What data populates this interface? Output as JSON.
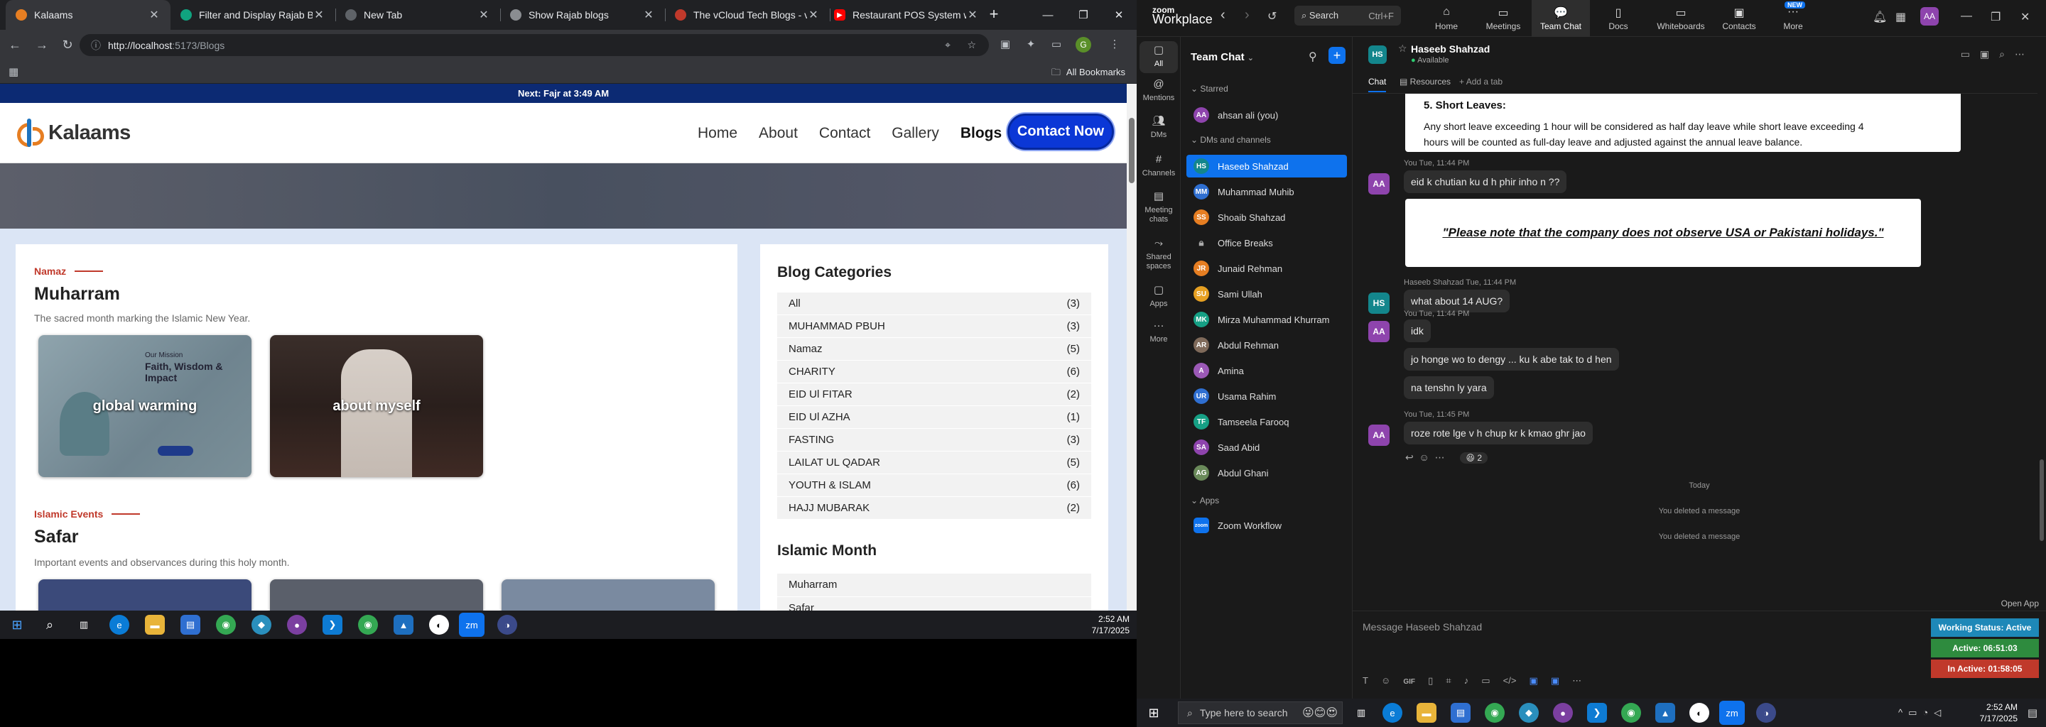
{
  "browser": {
    "tabs": [
      {
        "title": "Kalaams",
        "fav_color": "#e67e22",
        "active": true
      },
      {
        "title": "Filter and Display Rajab Blog",
        "fav_color": "#10a37f"
      },
      {
        "title": "New Tab",
        "fav_color": "#35363a"
      },
      {
        "title": "Show Rajab blogs",
        "fav_color": "#5f6368"
      },
      {
        "title": "The vCloud Tech Blogs - vClo",
        "fav_color": "#c0392b"
      },
      {
        "title": "Restaurant POS System with",
        "fav_color": "#ff0000"
      }
    ],
    "url_host": "http://localhost",
    "url_path": ":5173/Blogs",
    "bookmarks_label": "All Bookmarks",
    "profile_initial": "G"
  },
  "site": {
    "prayer_notice": "Next: Fajr at 3:49 AM",
    "logo_text": "Kalaams",
    "nav": [
      "Home",
      "About",
      "Contact",
      "Gallery",
      "Blogs"
    ],
    "cta": "Contact Now",
    "sections": [
      {
        "kicker": "Namaz",
        "title": "Muharram",
        "subtitle": "The sacred month marking the Islamic New Year.",
        "cards": [
          {
            "label": "global warming",
            "overlay_lines": [
              "Our Mission",
              "Faith, Wisdom &",
              "Impact"
            ]
          },
          {
            "label": "about myself"
          }
        ]
      },
      {
        "kicker": "Islamic Events",
        "title": "Safar",
        "subtitle": "Important events and observances during this holy month."
      }
    ],
    "sidebar": {
      "categories_title": "Blog Categories",
      "categories": [
        {
          "name": "All",
          "count": "(3)"
        },
        {
          "name": "MUHAMMAD PBUH",
          "count": "(3)"
        },
        {
          "name": "Namaz",
          "count": "(5)"
        },
        {
          "name": "CHARITY",
          "count": "(6)"
        },
        {
          "name": "EID Ul FITAR",
          "count": "(2)"
        },
        {
          "name": "EID Ul AZHA",
          "count": "(1)"
        },
        {
          "name": "FASTING",
          "count": "(3)"
        },
        {
          "name": "LAILAT UL QADAR",
          "count": "(5)"
        },
        {
          "name": "YOUTH & ISLAM",
          "count": "(6)"
        },
        {
          "name": "HAJJ MUBARAK",
          "count": "(2)"
        }
      ],
      "months_title": "Islamic Month",
      "months": [
        "Muharram",
        "Safar"
      ]
    }
  },
  "taskbar_left": {
    "time": "2:52 AM",
    "date": "7/17/2025"
  },
  "zoom": {
    "brand_top": "zoom",
    "brand_bottom": "Workplace",
    "search_label": "Search",
    "search_shortcut": "Ctrl+F",
    "tabs": [
      {
        "label": "Home"
      },
      {
        "label": "Meetings"
      },
      {
        "label": "Team Chat",
        "active": true
      },
      {
        "label": "Docs"
      },
      {
        "label": "Whiteboards"
      },
      {
        "label": "Contacts"
      },
      {
        "label": "More",
        "badge": "NEW"
      }
    ],
    "user_initials": "AA",
    "rail": [
      {
        "label": "All",
        "active": true
      },
      {
        "label": "Mentions"
      },
      {
        "label": "DMs"
      },
      {
        "label": "Channels"
      },
      {
        "label": "Meeting chats"
      },
      {
        "label": "Shared spaces"
      },
      {
        "label": "Apps"
      },
      {
        "label": "More"
      }
    ],
    "list_title": "Team Chat",
    "groups": {
      "starred": "Starred",
      "dms": "DMs and channels",
      "apps": "Apps"
    },
    "starred": [
      {
        "name": "ahsan ali (you)",
        "initials": "AA",
        "color": "#8e44ad"
      }
    ],
    "dms": [
      {
        "name": "Haseeb Shahzad",
        "initials": "HS",
        "color": "#13868c",
        "active": true
      },
      {
        "name": "Muhammad Muhib",
        "initials": "MM",
        "color": "#2f6fd1"
      },
      {
        "name": "Shoaib Shahzad",
        "initials": "SS",
        "color": "#e67e22"
      },
      {
        "name": "Office Breaks",
        "initials": "",
        "color": "#555"
      },
      {
        "name": "Junaid Rehman",
        "initials": "JR",
        "color": "#e67e22"
      },
      {
        "name": "Sami Ullah",
        "initials": "SU",
        "color": "#e6a022"
      },
      {
        "name": "Mirza Muhammad Khurram",
        "initials": "MK",
        "color": "#16a085"
      },
      {
        "name": "Abdul Rehman",
        "initials": "AR",
        "color": "#7f6a5a"
      },
      {
        "name": "Amina",
        "initials": "A",
        "color": "#9b59b6"
      },
      {
        "name": "Usama Rahim",
        "initials": "UR",
        "color": "#2f6fd1"
      },
      {
        "name": "Tamseela Farooq",
        "initials": "TF",
        "color": "#16a085"
      },
      {
        "name": "Saad Abid",
        "initials": "SA",
        "color": "#8e44ad"
      },
      {
        "name": "Abdul Ghani",
        "initials": "AG",
        "color": "#6a8a5a"
      }
    ],
    "apps": [
      {
        "name": "Zoom Workflow",
        "initials": "zoom",
        "color": "#0e72ed"
      }
    ],
    "chat": {
      "contact_name": "Haseeb Shahzad",
      "contact_initials": "HS",
      "presence": "Available",
      "tabs": [
        "Chat",
        "Resources",
        "Add a tab"
      ],
      "leave_heading": "5. Short Leaves:",
      "leave_text_1": "Any short leave exceeding 1 hour will be considered as half day leave while short leave exceeding 4",
      "leave_text_2": "hours will be counted as full-day leave and adjusted against the annual leave balance.",
      "notice": "\"Please note that the company does not observe USA or Pakistani holidays.\"",
      "messages": [
        {
          "meta": "You Tue, 11:44 PM",
          "text": "eid k chutian ku d h phir inho n ??",
          "initials": "AA"
        },
        {
          "meta": "Haseeb Shahzad  Tue, 11:44 PM",
          "text": "what about 14 AUG?",
          "initials": "HS"
        },
        {
          "meta": "You Tue, 11:44 PM",
          "text": "idk",
          "initials": "AA"
        },
        {
          "text": "jo honge wo to dengy ... ku k abe tak to d hen"
        },
        {
          "text": "na tenshn ly yara"
        },
        {
          "meta": "You Tue, 11:45 PM",
          "text": "roze rote lge v h chup kr k kmao ghr jao",
          "initials": "AA"
        }
      ],
      "reaction_count": "2",
      "day_divider": "Today",
      "deleted_1": "You deleted a message",
      "deleted_2": "You deleted a message",
      "compose_placeholder": "Message Haseeb Shahzad",
      "open_app": "Open App",
      "working_status": "Working Status: Active",
      "active_time": "Active: 06:51:03",
      "inactive_time": "In Active: 01:58:05"
    }
  },
  "taskbar_right": {
    "search_placeholder": "Type here to search",
    "time": "2:52 AM",
    "date": "7/17/2025"
  }
}
